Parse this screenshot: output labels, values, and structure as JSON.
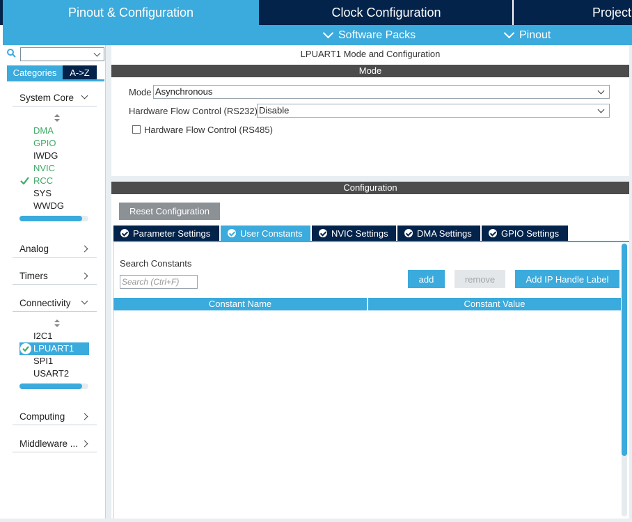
{
  "top_tabs": {
    "pinout": "Pinout & Configuration",
    "clock": "Clock Configuration",
    "project": "Project"
  },
  "subbar": {
    "software_packs": "Software Packs",
    "pinout": "Pinout"
  },
  "left": {
    "search_value": "",
    "tabs": {
      "categories": "Categories",
      "az": "A->Z"
    },
    "categories": {
      "system_core": "System Core",
      "analog": "Analog",
      "timers": "Timers",
      "connectivity": "Connectivity",
      "computing": "Computing",
      "middleware": "Middleware ..."
    },
    "system_core_items": [
      "DMA",
      "GPIO",
      "IWDG",
      "NVIC",
      "RCC",
      "SYS",
      "WWDG"
    ],
    "connectivity_items": [
      "I2C1",
      "LPUART1",
      "SPI1",
      "USART2"
    ]
  },
  "main": {
    "title": "LPUART1 Mode and Configuration",
    "mode_bar": "Mode",
    "mode_label": "Mode",
    "mode_value": "Asynchronous",
    "flow232_label": "Hardware Flow Control (RS232)",
    "flow232_value": "Disable",
    "flow485_label": "Hardware Flow Control (RS485)",
    "config_bar": "Configuration",
    "reset_button": "Reset Configuration",
    "tabs": [
      "Parameter Settings",
      "User Constants",
      "NVIC Settings",
      "DMA Settings",
      "GPIO Settings"
    ],
    "search_constants_label": "Search Constants",
    "search_placeholder": "Search (Ctrl+F)",
    "add_button": "add",
    "remove_button": "remove",
    "handle_button": "Add IP Handle Label",
    "columns": [
      "Constant Name",
      "Constant Value"
    ]
  },
  "colors": {
    "accent": "#3baadc",
    "navy": "#03234b",
    "enabled_green": "#3fa965",
    "bar_gray": "#4c4c4c"
  }
}
